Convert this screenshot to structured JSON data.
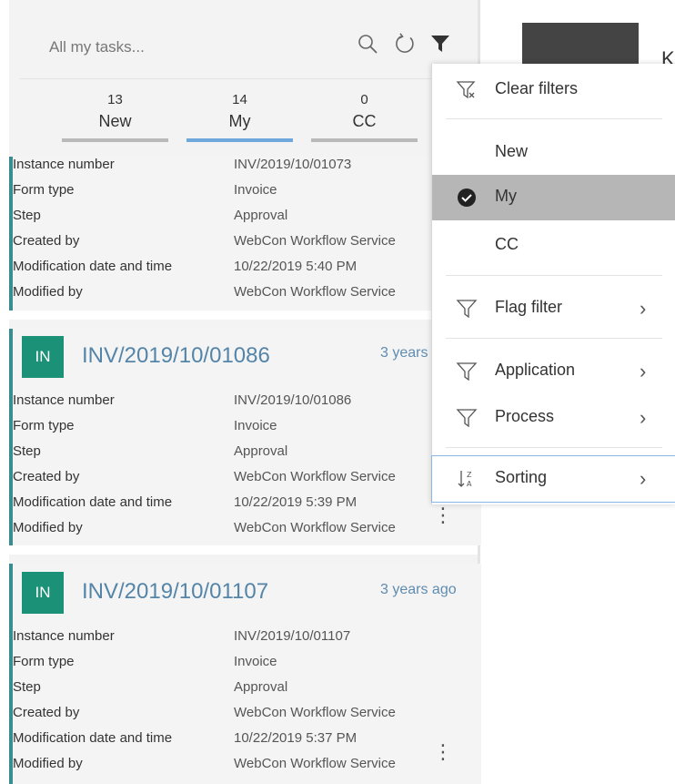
{
  "search": {
    "placeholder": "All my tasks..."
  },
  "tabs": [
    {
      "count": "13",
      "label": "New"
    },
    {
      "count": "14",
      "label": "My"
    },
    {
      "count": "0",
      "label": "CC"
    }
  ],
  "field_labels": [
    "Instance number",
    "Form type",
    "Step",
    "Created by",
    "Modification date and time",
    "Modified by"
  ],
  "cards": [
    {
      "values": [
        "INV/2019/10/01073",
        "Invoice",
        "Approval",
        "WebCon Workflow Service",
        "10/22/2019 5:40 PM",
        "WebCon Workflow Service"
      ]
    },
    {
      "badge": "IN",
      "title": "INV/2019/10/01086",
      "time": "3 years",
      "values": [
        "INV/2019/10/01086",
        "Invoice",
        "Approval",
        "WebCon Workflow Service",
        "10/22/2019 5:39 PM",
        "WebCon Workflow Service"
      ]
    },
    {
      "badge": "IN",
      "title": "INV/2019/10/01107",
      "time": "3 years ago",
      "values": [
        "INV/2019/10/01107",
        "Invoice",
        "Approval",
        "WebCon Workflow Service",
        "10/22/2019 5:37 PM",
        "WebCon Workflow Service"
      ]
    }
  ],
  "kebab": "⋮",
  "right_edge_letter": "K",
  "menu": {
    "clear_filters": "Clear filters",
    "new": "New",
    "my": "My",
    "cc": "CC",
    "flag_filter": "Flag filter",
    "application": "Application",
    "process": "Process",
    "sorting": "Sorting",
    "chevron": "›"
  },
  "colors": {
    "accent_blue": "#6ea8dc",
    "badge_green": "#1b9277",
    "card_border": "#3a8d8f",
    "title_blue": "#5485a8",
    "selected_gray": "#b6b6b6"
  },
  "icons": {
    "search": "search-icon",
    "refresh": "refresh-icon",
    "filter": "filter-icon",
    "clear_filter": "clear-filter-icon",
    "check": "check-circle-icon",
    "funnel": "funnel-outline-icon",
    "sort": "sort-az-icon",
    "chevron": "chevron-right-icon",
    "more": "more-vertical-icon"
  }
}
